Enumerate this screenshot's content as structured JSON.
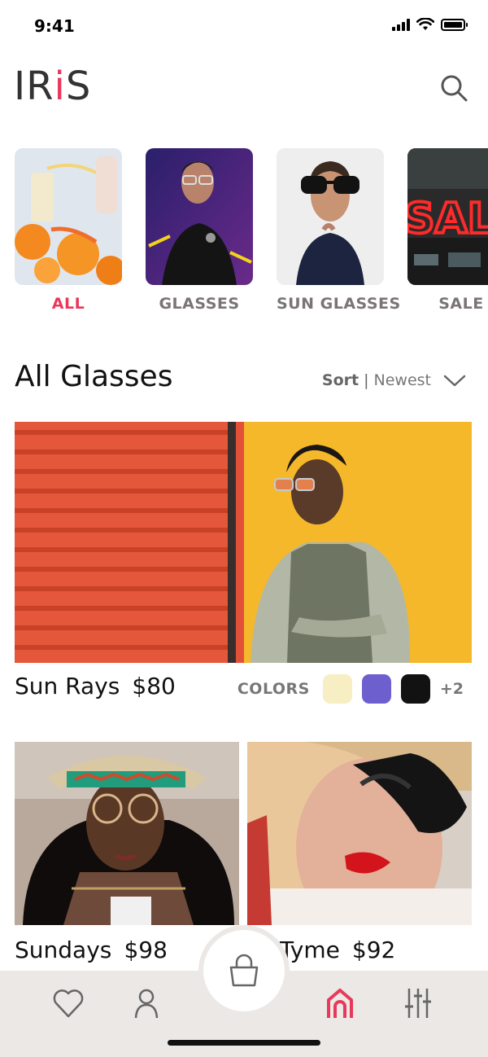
{
  "status": {
    "time": "9:41"
  },
  "header": {
    "logo_left": "IR",
    "logo_i": "i",
    "logo_right": "S"
  },
  "categories": [
    {
      "label": "ALL",
      "active": true
    },
    {
      "label": "GLASSES",
      "active": false
    },
    {
      "label": "SUN GLASSES",
      "active": false
    },
    {
      "label": "SALE",
      "active": false
    }
  ],
  "section": {
    "title": "All Glasses",
    "sort_label": "Sort",
    "sort_separator": "|",
    "sort_value": "Newest"
  },
  "featured": {
    "name": "Sun Rays",
    "price": "$80",
    "colors_label": "COLORS",
    "colors": [
      "#f7eec4",
      "#6e5fcf",
      "#121212"
    ],
    "more_colors": "+2"
  },
  "products": [
    {
      "name": "Sundays",
      "price": "$98"
    },
    {
      "name": "Tyme",
      "price": "$92"
    }
  ],
  "sale_sign": "SAL",
  "theme": {
    "accent": "#e8395b",
    "text": "#111111",
    "muted": "#777777",
    "tabbar": "#ebe8e6"
  },
  "tabbar": {
    "icons": [
      "heart-icon",
      "user-icon",
      "basket-icon",
      "home-icon",
      "sliders-icon"
    ],
    "active": "home-icon"
  }
}
